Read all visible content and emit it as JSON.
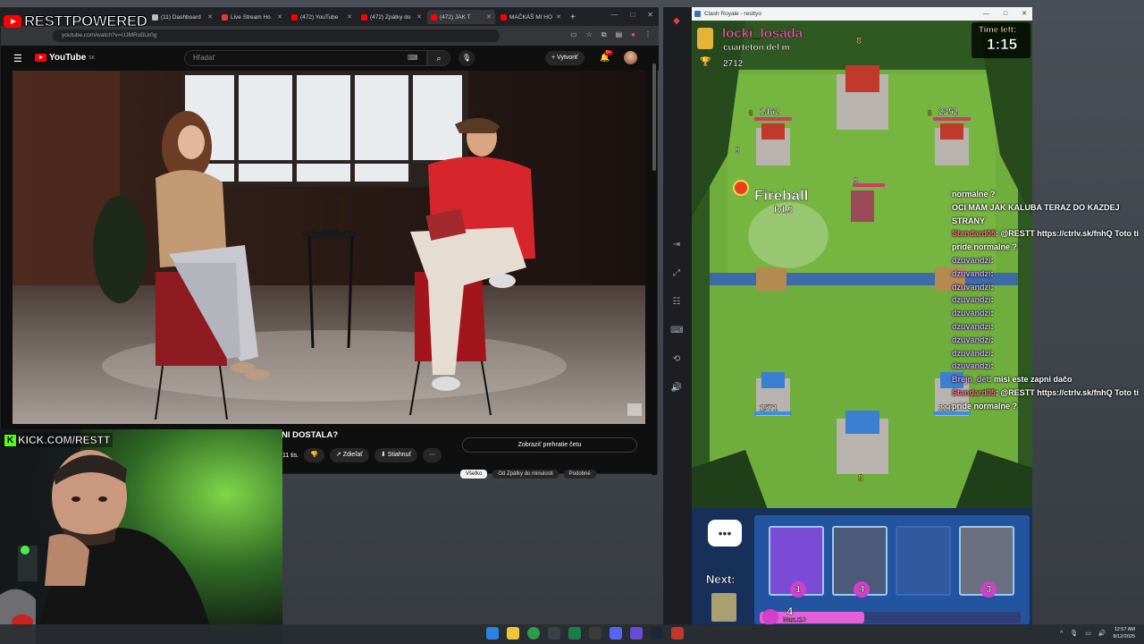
{
  "overlay": {
    "brand": "RESTTPOWERED",
    "kick_url": "KICK.COM/RESTT"
  },
  "browser": {
    "tabs": [
      {
        "label": "(11) Dashboard",
        "color": "#bbbbbb"
      },
      {
        "label": "Live Stream Ho",
        "color": "#e53935"
      },
      {
        "label": "(472) YouTube",
        "color": "#ff0000"
      },
      {
        "label": "(472) Zpátky do",
        "color": "#ff0000"
      },
      {
        "label": "(472) JAK T",
        "color": "#ff0000"
      },
      {
        "label": "MAČKÁŠ MI HO",
        "color": "#ff0000"
      }
    ],
    "address": "youtube.com/watch?v=UJMRxBLk0g"
  },
  "youtube": {
    "logo": "YouTube",
    "region": "SK",
    "search_placeholder": "Hľadať",
    "create_label": "Vytvoriť",
    "notif_count": "9+",
    "video_title": "NI DOSTALA?",
    "likes": "11 tis.",
    "share_label": "Zdieľať",
    "download_label": "Stiahnuť",
    "chat_replay_label": "Zobraziť prehratie četu",
    "chips": [
      "Všetko",
      "Od Zpátky do minulosti",
      "Podobné"
    ]
  },
  "game": {
    "window_title": "Clash Royale - resttyo",
    "opponent_name": "locki_losada",
    "opponent_clan": "cuarteton del m",
    "opponent_trophies": "2712",
    "opponent_king_level": "8",
    "time_left_label": "Time left:",
    "time_left": "1:15",
    "enemy_left_tower_hp": "1462",
    "enemy_right_tower_hp": "2352",
    "enemy_tower_level_l": "8",
    "enemy_tower_level_r": "8",
    "troop_level_a": "9",
    "troop_level_b": "9",
    "spell_name": "Fireball",
    "spell_level": "lvl.9",
    "my_left_tower_hp": "1571",
    "my_right_tower_hp": "2216",
    "my_king_level": "9",
    "next_label": "Next:",
    "elixir": "4",
    "elixir_fill": 0.4,
    "elixir_max": "Max.:10",
    "cards": [
      {
        "name": "electro-spirit-card",
        "cost": "1",
        "color": "#7b4bd6"
      },
      {
        "name": "mega-knight-card",
        "cost": "4",
        "color": "#4a5a78"
      },
      {
        "name": "empty-card-slot",
        "cost": "",
        "color": "#2f5aa0"
      },
      {
        "name": "skeleton-knight-card",
        "cost": "3",
        "color": "#6a7080"
      }
    ]
  },
  "chat": [
    {
      "user": "",
      "msg": "normalne ?",
      "cls": "u"
    },
    {
      "user": "",
      "msg": "OCI MAM JAK KALUBA TERAZ DO KAZDEJ STRANY",
      "cls": "u2"
    },
    {
      "user": "Standard05",
      "msg": "@RESTT https://ctrlv.sk/fnhQ Toto ti pride normalne ?",
      "cls": "u3"
    },
    {
      "user": "dzuvandzi",
      "msg": "",
      "cls": "u"
    },
    {
      "user": "dzuvandzi",
      "msg": "",
      "cls": "u"
    },
    {
      "user": "dzuvandzi",
      "msg": "",
      "cls": "u"
    },
    {
      "user": "dzuvandzi",
      "msg": "",
      "cls": "u"
    },
    {
      "user": "dzuvandzi",
      "msg": "",
      "cls": "u"
    },
    {
      "user": "dzuvandzi",
      "msg": "",
      "cls": "u"
    },
    {
      "user": "dzuvandzi",
      "msg": "",
      "cls": "u"
    },
    {
      "user": "dzuvandzi",
      "msg": "",
      "cls": "u"
    },
    {
      "user": "dzuvandzi",
      "msg": "",
      "cls": "u"
    },
    {
      "user": "Brejn_det",
      "msg": "misi este zapni dačo",
      "cls": "u"
    },
    {
      "user": "Standard05",
      "msg": "@RESTT https://ctrlv.sk/fnhQ Toto ti pride normalne ?",
      "cls": "u3"
    }
  ],
  "taskbar": {
    "time": "12:57 AM",
    "date": "8/12/2025"
  }
}
